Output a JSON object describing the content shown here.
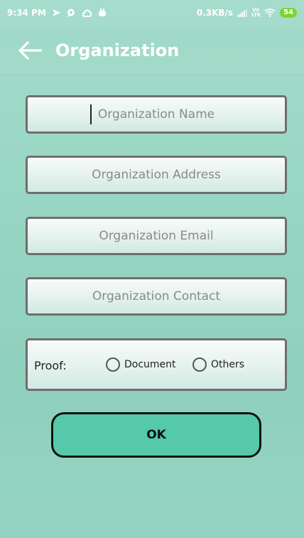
{
  "status_bar": {
    "time": "9:34 PM",
    "network_speed": "0.3KB/s",
    "volte_label": "Vo LTE",
    "battery": "54",
    "icons": [
      "navigation-icon",
      "message-icon",
      "cloud-icon",
      "notification-icon",
      "signal-icon",
      "wifi-icon",
      "battery-icon"
    ]
  },
  "app_bar": {
    "title": "Organization",
    "back_icon": "back-arrow-icon"
  },
  "form": {
    "name_placeholder": "Organization Name",
    "address_placeholder": "Organization Address",
    "email_placeholder": "Organization Email",
    "contact_placeholder": "Organization Contact",
    "proof_label": "Proof:",
    "proof_options": [
      "Document",
      "Others"
    ],
    "ok_label": "OK"
  },
  "colors": {
    "background": "#99d6c4",
    "button": "#55c9aa",
    "battery": "#7bd62f"
  }
}
